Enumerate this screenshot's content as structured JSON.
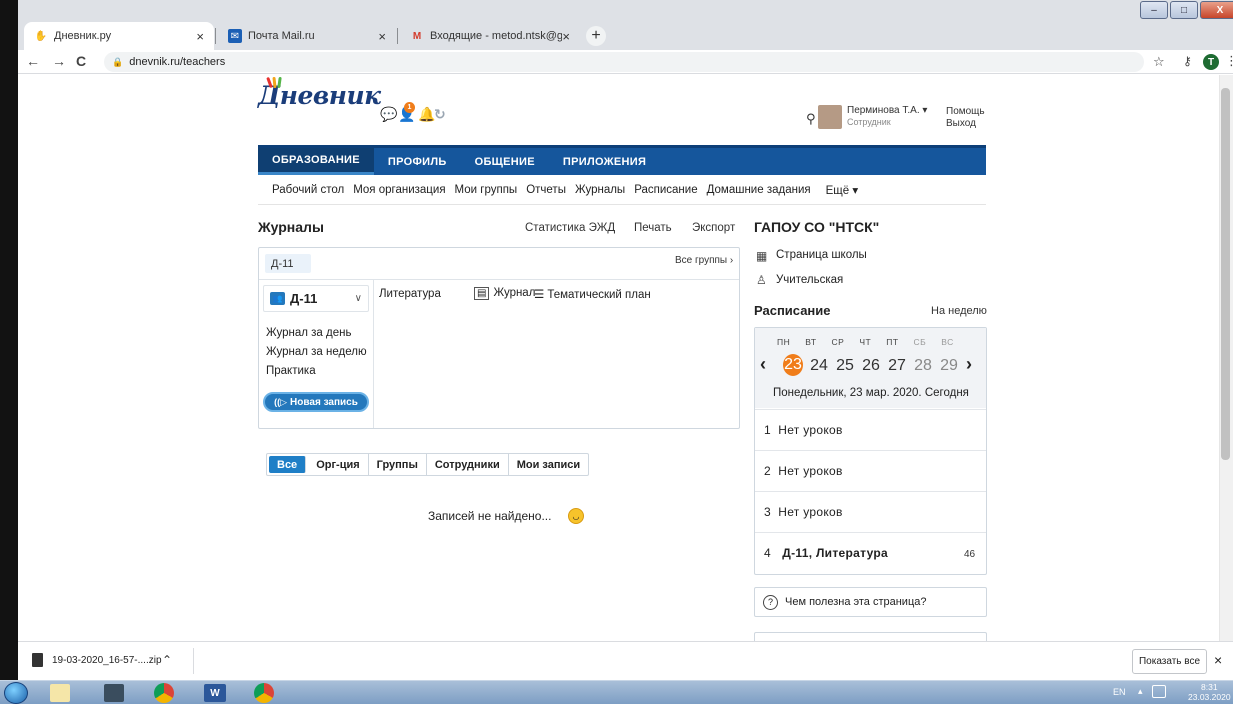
{
  "browser": {
    "tabs": [
      {
        "title": "Дневник.ру",
        "icon": "dnevnik-favicon",
        "close": "×"
      },
      {
        "title": "Почта Mail.ru",
        "icon": "mail-ru-favicon",
        "close": ""
      },
      {
        "title": "Входящие - metod.ntsk@gmail.c",
        "icon": "gmail-favicon",
        "close": "×"
      }
    ],
    "new_tab": "+",
    "url": "dnevnik.ru/teachers",
    "profile_initial": "T",
    "window_buttons": {
      "min": "–",
      "max": "□",
      "close": "X"
    }
  },
  "header": {
    "logo": "Дневник",
    "notification_count": "1",
    "user_name": "Перминова Т.А. ▾",
    "user_role": "Сотрудник",
    "help": "Помощь",
    "logout": "Выход"
  },
  "main_nav": [
    "ОБРАЗОВАНИЕ",
    "ПРОФИЛЬ",
    "ОБЩЕНИЕ",
    "ПРИЛОЖЕНИЯ"
  ],
  "sub_nav": [
    "Рабочий стол",
    "Моя организация",
    "Мои группы",
    "Отчеты",
    "Журналы",
    "Расписание",
    "Домашние задания",
    "Ещё ▾"
  ],
  "journals": {
    "title": "Журналы",
    "links": [
      "Статистика ЭЖД",
      "Печать",
      "Экспорт"
    ],
    "group_chip": "Д-11",
    "all_groups": "Все группы ›",
    "group_name": "Д-11",
    "group_links": [
      "Журнал за день",
      "Журнал за неделю",
      "Практика"
    ],
    "new_entry": "Новая запись",
    "subject": "Литература",
    "journal_link": "Журнал",
    "theme_link": "Тематический план"
  },
  "filters": [
    "Все",
    "Орг-ция",
    "Группы",
    "Сотрудники",
    "Мои записи"
  ],
  "empty_message": "Записей не найдено...",
  "school": {
    "name": "ГАПОУ СО \"НТСК\"",
    "links": [
      "Страница школы",
      "Учительская"
    ]
  },
  "schedule": {
    "title": "Расписание",
    "week_link": "На неделю",
    "day_names": [
      "ПН",
      "ВТ",
      "СР",
      "ЧТ",
      "ПТ",
      "СБ",
      "ВС"
    ],
    "dates": [
      "23",
      "24",
      "25",
      "26",
      "27",
      "28",
      "29"
    ],
    "current_date": "Понедельник, 23 мар. 2020. Сегодня",
    "lessons": [
      {
        "num": "1",
        "text": "Нет уроков"
      },
      {
        "num": "2",
        "text": "Нет уроков"
      },
      {
        "num": "3",
        "text": "Нет уроков"
      },
      {
        "num": "4",
        "text": "Д-11, Литература",
        "count": "46"
      }
    ],
    "useful": "Чем полезна эта страница?"
  },
  "downloads": {
    "file": "19-03-2020_16-57-....zip",
    "show_all": "Показать все",
    "close": "×"
  },
  "taskbar": {
    "lang": "EN",
    "time": "8:31",
    "date": "23.03.2020"
  },
  "colors": {
    "nav_blue": "#15569c",
    "accent_blue": "#1f7fc7",
    "today_orange": "#f07d1a"
  }
}
